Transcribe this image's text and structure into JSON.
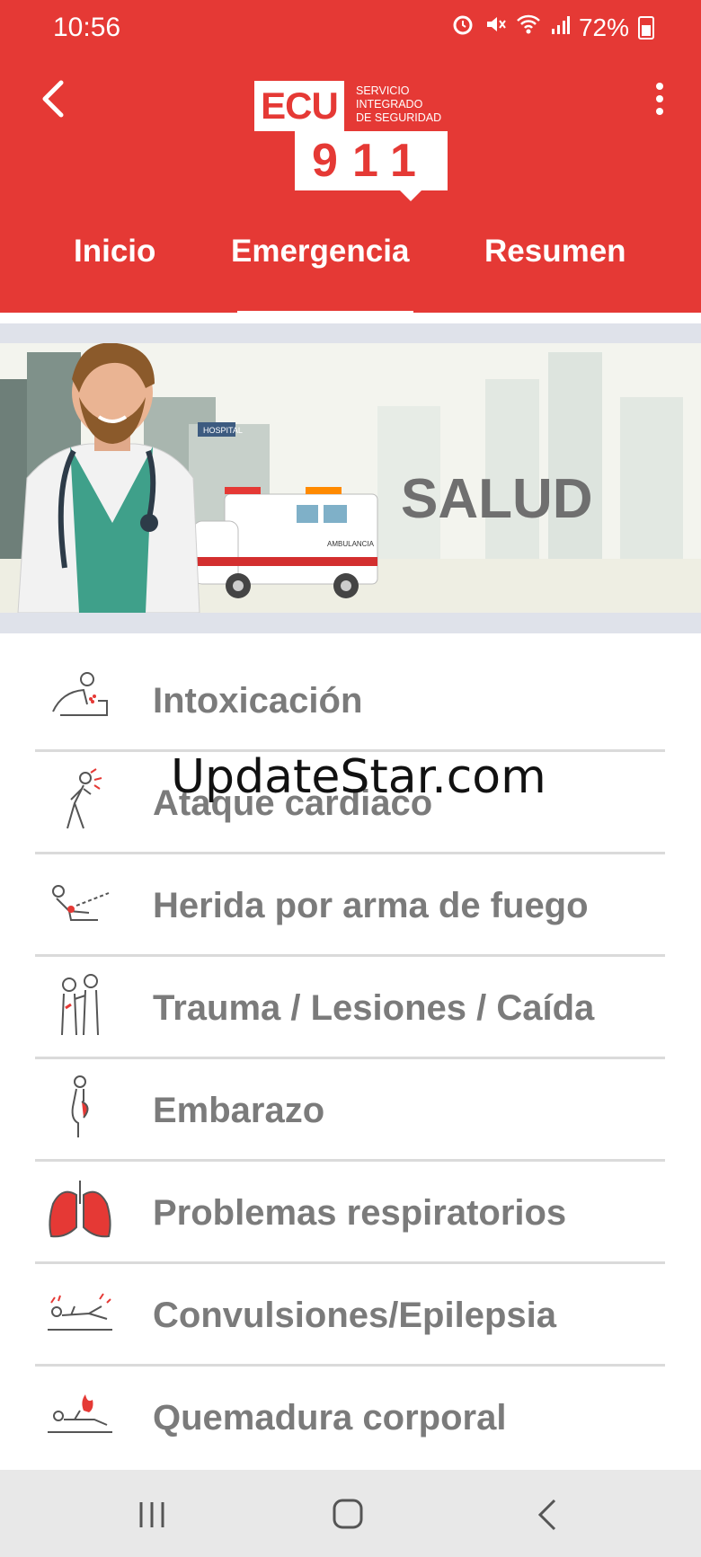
{
  "status_bar": {
    "time": "10:56",
    "battery": "72%"
  },
  "header": {
    "logo_top": "ECU",
    "logo_service": [
      "SERVICIO",
      "INTEGRADO",
      "DE SEGURIDAD"
    ],
    "logo_number": "911",
    "tabs": [
      {
        "label": "Inicio"
      },
      {
        "label": "Emergencia",
        "selected": true
      },
      {
        "label": "Resumen"
      }
    ]
  },
  "banner": {
    "title": "SALUD",
    "hospital_sign": "HOSPITAL",
    "ambulance_text": "AMBULANCIA"
  },
  "watermark": "UpdateStar.com",
  "items": [
    {
      "label": "Intoxicación",
      "icon": "poisoning-icon"
    },
    {
      "label": "Ataque cardiaco",
      "icon": "heart-attack-icon"
    },
    {
      "label": "Herida por arma de fuego",
      "icon": "gunshot-wound-icon"
    },
    {
      "label": "Trauma / Lesiones / Caída",
      "icon": "trauma-icon"
    },
    {
      "label": "Embarazo",
      "icon": "pregnancy-icon"
    },
    {
      "label": "Problemas respiratorios",
      "icon": "lungs-icon"
    },
    {
      "label": "Convulsiones/Epilepsia",
      "icon": "seizure-icon"
    },
    {
      "label": "Quemadura corporal",
      "icon": "burn-icon"
    }
  ],
  "colors": {
    "primary": "#e53935",
    "label_gray": "#7b7b7b",
    "accent_red": "#e53935"
  }
}
